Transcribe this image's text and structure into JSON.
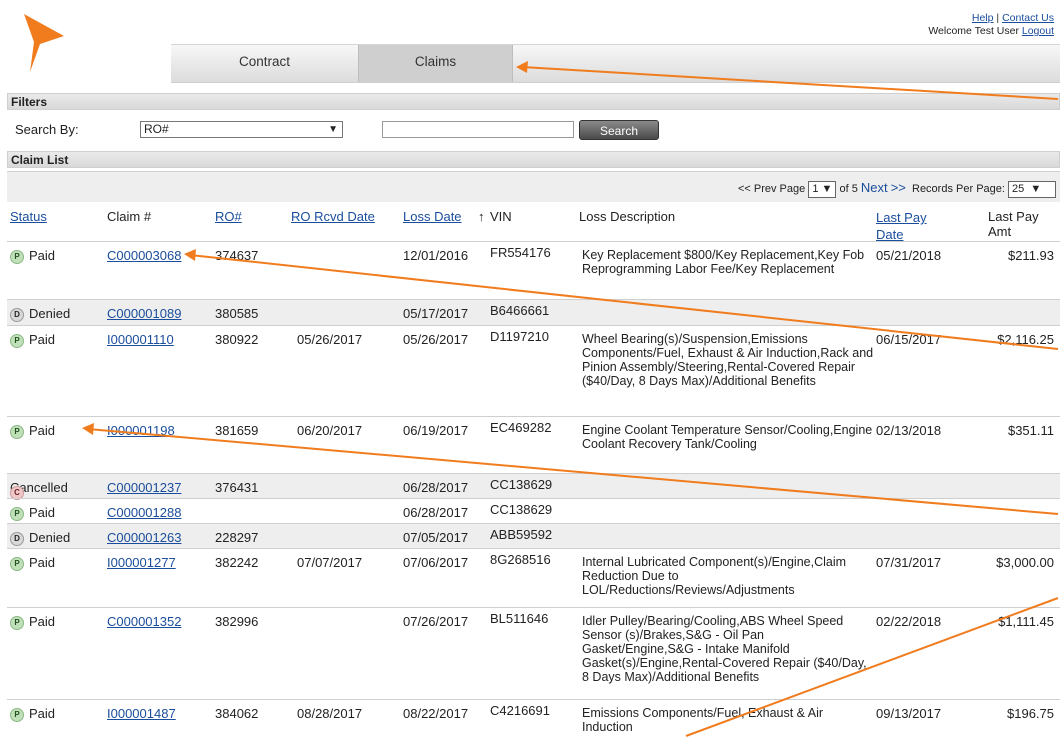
{
  "header": {
    "help": "Help",
    "contact": "Contact Us",
    "welcome": "Welcome Test User",
    "logout": "Logout"
  },
  "tabs": {
    "contract": "Contract",
    "claims": "Claims"
  },
  "filters": {
    "title": "Filters",
    "search_by_label": "Search By:",
    "search_by_value": "RO#",
    "search_value": "",
    "search_button": "Search"
  },
  "claim_list": {
    "title": "Claim List"
  },
  "pager": {
    "prev": "<< Prev Page",
    "page": "1",
    "of": "of 5",
    "next": "Next",
    "next_arrows": ">>",
    "rpp_label": "Records Per Page:",
    "rpp": "25"
  },
  "columns": {
    "status": "Status",
    "claim": "Claim #",
    "ro": "RO#",
    "ro_rcvd": "RO Rcvd Date",
    "loss_date": "Loss Date",
    "sort": "↑",
    "vin": "VIN",
    "loss_desc": "Loss Description",
    "last_pay_date_1": "Last Pay",
    "last_pay_date_2": "Date",
    "last_pay_amt": "Last Pay Amt"
  },
  "rows": [
    {
      "status": "Paid",
      "code": "P",
      "claim": "C000003068",
      "ro": "374637",
      "ro_rcvd": "",
      "loss_date": "12/01/2016",
      "vin": "FR554176",
      "desc": "Key Replacement $800/Key Replacement,Key Fob Reprogramming Labor Fee/Key Replacement",
      "pay_date": "05/21/2018",
      "pay_amt": "$211.93"
    },
    {
      "status": "Denied",
      "code": "D",
      "claim": "C000001089",
      "ro": "380585",
      "ro_rcvd": "",
      "loss_date": "05/17/2017",
      "vin": "B6466661",
      "desc": "",
      "pay_date": "",
      "pay_amt": ""
    },
    {
      "status": "Paid",
      "code": "P",
      "claim": "I000001110",
      "ro": "380922",
      "ro_rcvd": "05/26/2017",
      "loss_date": "05/26/2017",
      "vin": "D1197210",
      "desc": "Wheel Bearing(s)/Suspension,Emissions Components/Fuel, Exhaust & Air Induction,Rack and Pinion Assembly/Steering,Rental-Covered Repair ($40/Day, 8 Days Max)/Additional Benefits",
      "pay_date": "06/15/2017",
      "pay_amt": "$2,116.25"
    },
    {
      "status": "Paid",
      "code": "P",
      "claim": "I000001198",
      "ro": "381659",
      "ro_rcvd": "06/20/2017",
      "loss_date": "06/19/2017",
      "vin": "EC469282",
      "desc": "Engine Coolant Temperature Sensor/Cooling,Engine Coolant Recovery Tank/Cooling",
      "pay_date": "02/13/2018",
      "pay_amt": "$351.11"
    },
    {
      "status": "Cancelled",
      "code": "C",
      "claim": "C000001237",
      "ro": "376431",
      "ro_rcvd": "",
      "loss_date": "06/28/2017",
      "vin": "CC138629",
      "desc": "",
      "pay_date": "",
      "pay_amt": ""
    },
    {
      "status": "Paid",
      "code": "P",
      "claim": "C000001288",
      "ro": "",
      "ro_rcvd": "",
      "loss_date": "06/28/2017",
      "vin": "CC138629",
      "desc": "",
      "pay_date": "",
      "pay_amt": ""
    },
    {
      "status": "Denied",
      "code": "D",
      "claim": "C000001263",
      "ro": "228297",
      "ro_rcvd": "",
      "loss_date": "07/05/2017",
      "vin": "ABB59592",
      "desc": "",
      "pay_date": "",
      "pay_amt": ""
    },
    {
      "status": "Paid",
      "code": "P",
      "claim": "I000001277",
      "ro": "382242",
      "ro_rcvd": "07/07/2017",
      "loss_date": "07/06/2017",
      "vin": "8G268516",
      "desc": "Internal Lubricated Component(s)/Engine,Claim Reduction Due to LOL/Reductions/Reviews/Adjustments",
      "pay_date": "07/31/2017",
      "pay_amt": "$3,000.00"
    },
    {
      "status": "Paid",
      "code": "P",
      "claim": "C000001352",
      "ro": "382996",
      "ro_rcvd": "",
      "loss_date": "07/26/2017",
      "vin": "BL511646",
      "desc": "Idler Pulley/Bearing/Cooling,ABS Wheel Speed Sensor (s)/Brakes,S&G - Oil Pan Gasket/Engine,S&G - Intake Manifold Gasket(s)/Engine,Rental-Covered Repair ($40/Day, 8 Days Max)/Additional Benefits",
      "pay_date": "02/22/2018",
      "pay_amt": "$1,111.45"
    },
    {
      "status": "Paid",
      "code": "P",
      "claim": "I000001487",
      "ro": "384062",
      "ro_rcvd": "08/28/2017",
      "loss_date": "08/22/2017",
      "vin": "C4216691",
      "desc": "Emissions Components/Fuel, Exhaust & Air Induction",
      "pay_date": "09/13/2017",
      "pay_amt": "$196.75"
    }
  ],
  "colors": {
    "accent": "#f07c1e",
    "link": "#1a4d9c"
  }
}
